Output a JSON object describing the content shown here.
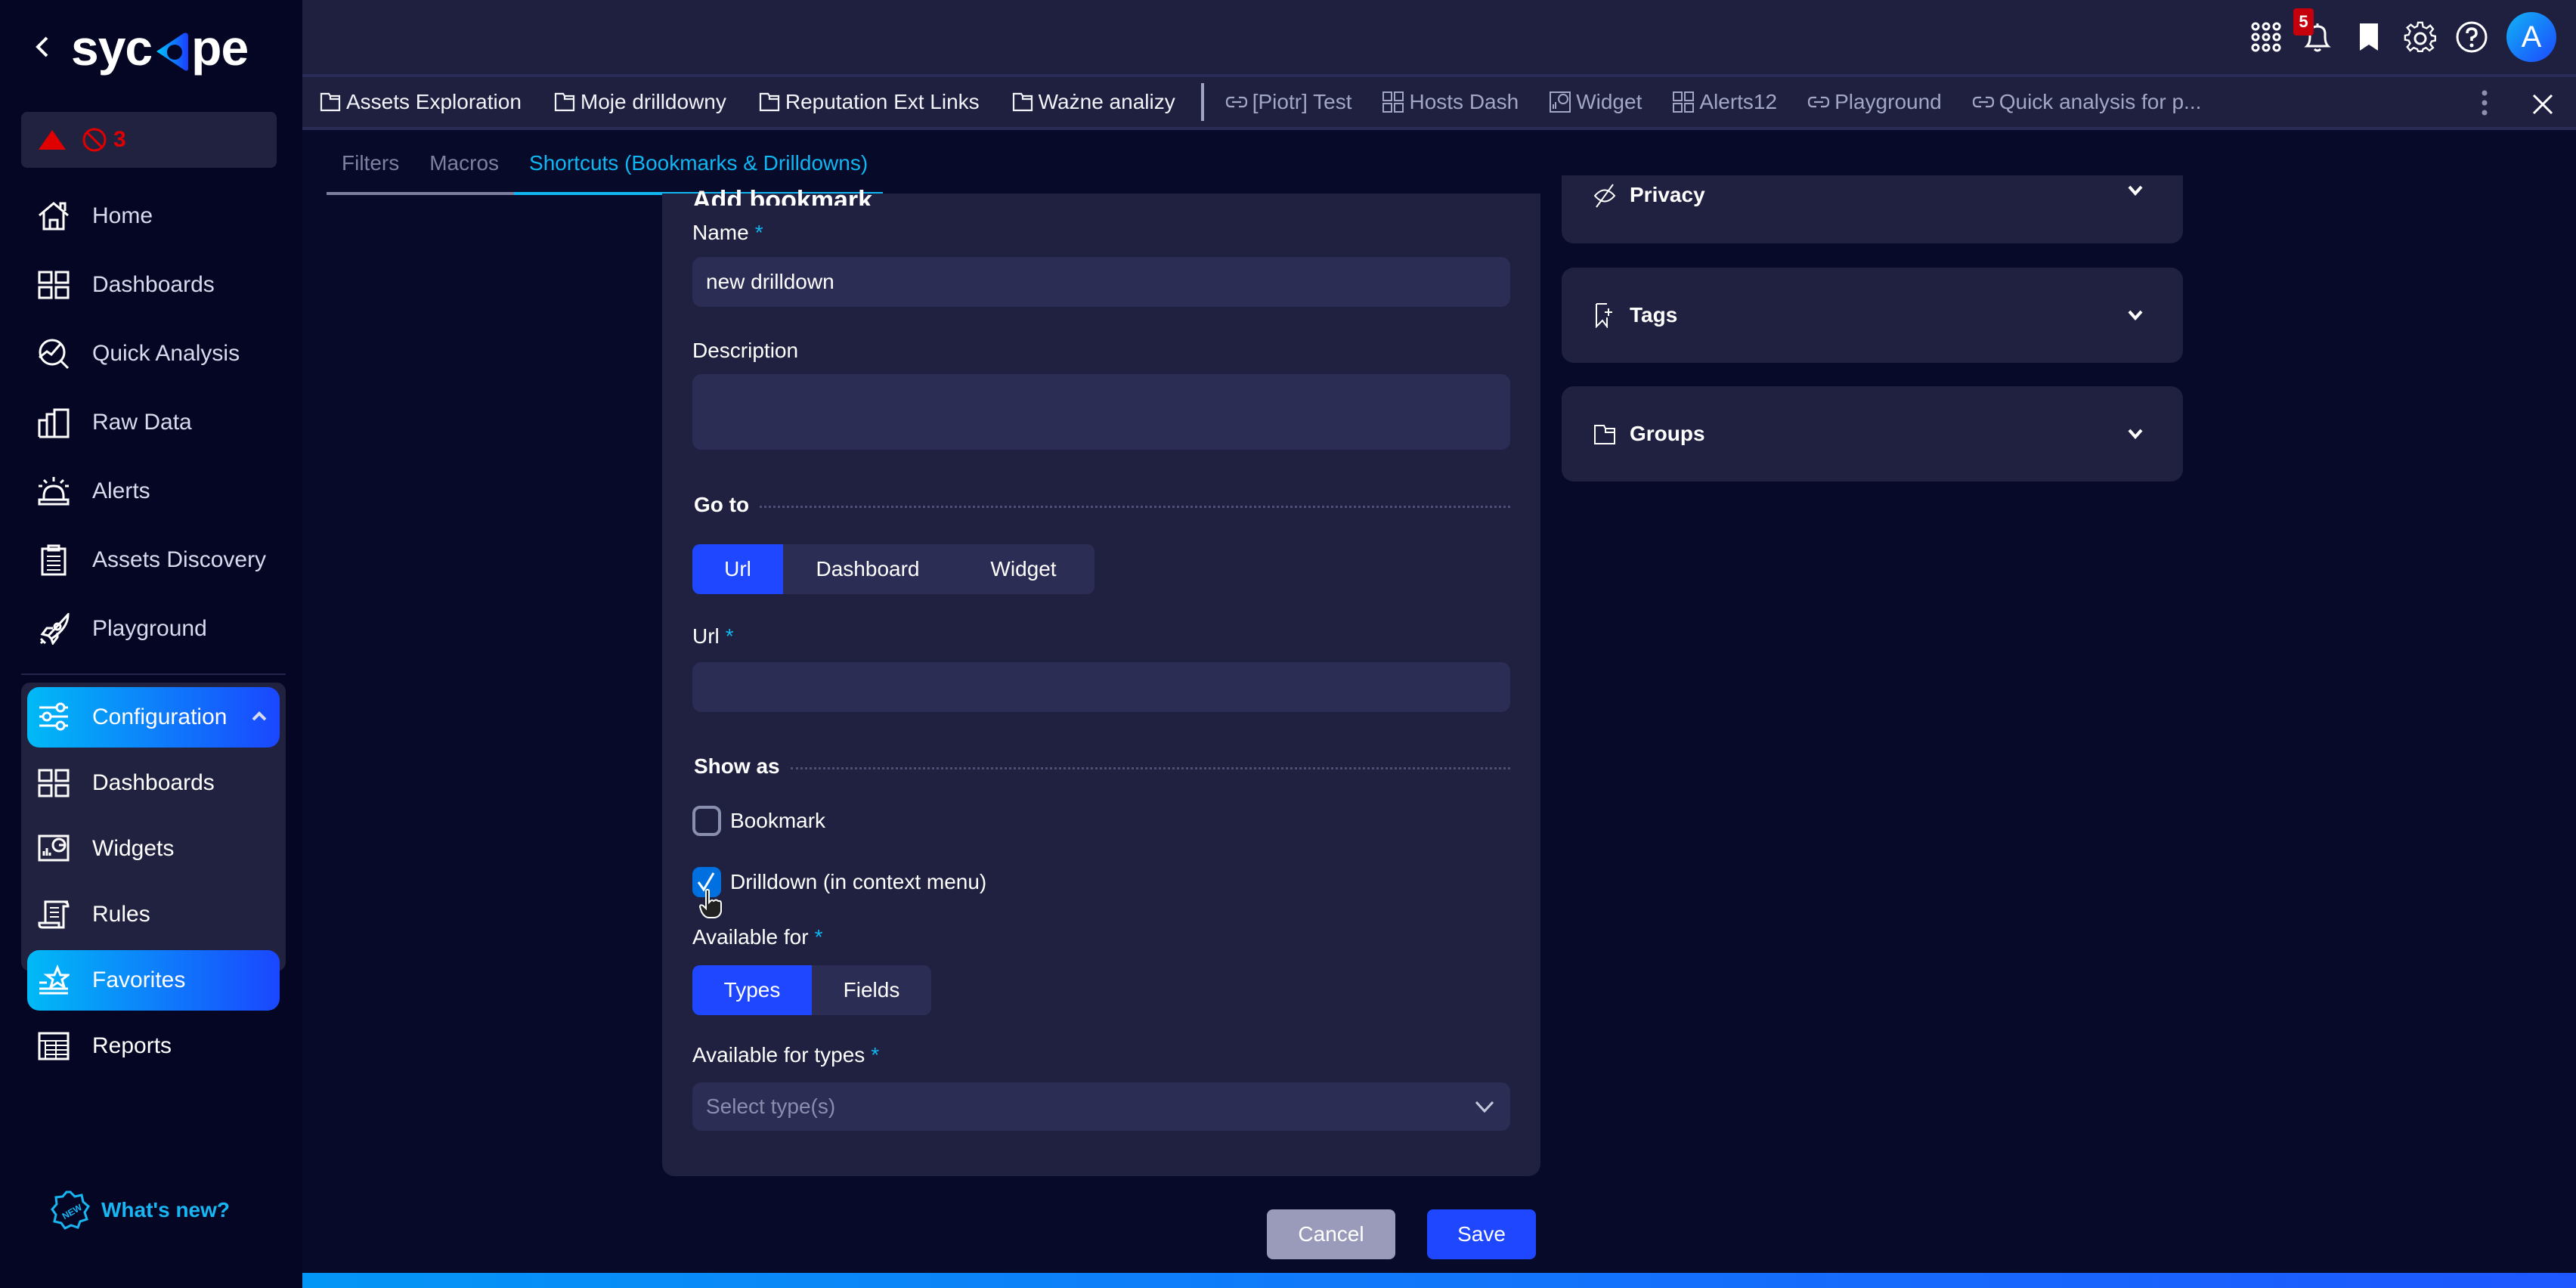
{
  "app": {
    "logo_text": "sycope"
  },
  "alerts": {
    "count": "3"
  },
  "sidebar": {
    "items": [
      {
        "label": "Home",
        "icon": "home-icon"
      },
      {
        "label": "Dashboards",
        "icon": "dashboards-icon"
      },
      {
        "label": "Quick Analysis",
        "icon": "quick-analysis-icon"
      },
      {
        "label": "Raw Data",
        "icon": "bar-chart-icon"
      },
      {
        "label": "Alerts",
        "icon": "siren-icon"
      },
      {
        "label": "Assets Discovery",
        "icon": "clipboard-icon"
      },
      {
        "label": "Playground",
        "icon": "rocket-icon"
      }
    ],
    "configuration": {
      "label": "Configuration",
      "expanded": true,
      "items": [
        {
          "label": "Dashboards",
          "icon": "dashboards-icon",
          "active": false
        },
        {
          "label": "Widgets",
          "icon": "widget-icon",
          "active": false
        },
        {
          "label": "Rules",
          "icon": "scroll-icon",
          "active": false
        },
        {
          "label": "Favorites",
          "icon": "star-list-icon",
          "active": true
        },
        {
          "label": "Reports",
          "icon": "table-icon",
          "active": false
        }
      ]
    },
    "whats_new": "What's new?"
  },
  "topbar": {
    "notification_count": "5",
    "avatar_initial": "A"
  },
  "shortcuts": {
    "folders": [
      "Assets Exploration",
      "Moje drilldowny",
      "Reputation Ext Links",
      "Ważne analizy"
    ],
    "links": [
      {
        "label": "[Piotr] Test",
        "icon": "link-icon"
      },
      {
        "label": "Hosts Dash",
        "icon": "dashboards-icon"
      },
      {
        "label": "Widget",
        "icon": "widget-icon"
      },
      {
        "label": "Alerts12",
        "icon": "dashboards-icon"
      },
      {
        "label": "Playground",
        "icon": "link-icon"
      },
      {
        "label": "Quick analysis for p...",
        "icon": "link-icon"
      }
    ]
  },
  "tabs": [
    {
      "label": "Filters",
      "active": false
    },
    {
      "label": "Macros",
      "active": false
    },
    {
      "label": "Shortcuts (Bookmarks & Drilldowns)",
      "active": true
    }
  ],
  "form": {
    "title": "Add bookmark",
    "name_label": "Name",
    "name_value": "new drilldown",
    "description_label": "Description",
    "description_value": "",
    "goto_section": "Go to",
    "goto_options": [
      {
        "label": "Url",
        "active": true
      },
      {
        "label": "Dashboard",
        "active": false
      },
      {
        "label": "Widget",
        "active": false
      }
    ],
    "url_label": "Url",
    "url_value": "",
    "show_as_section": "Show as",
    "bookmark_label": "Bookmark",
    "bookmark_checked": false,
    "drilldown_label": "Drilldown (in context menu)",
    "drilldown_checked": true,
    "available_for_label": "Available for",
    "available_for_options": [
      {
        "label": "Types",
        "active": true
      },
      {
        "label": "Fields",
        "active": false
      }
    ],
    "available_types_label": "Available for types",
    "available_types_placeholder": "Select type(s)",
    "required_marker": "*"
  },
  "panels": [
    {
      "label": "Privacy",
      "icon": "privacy-icon"
    },
    {
      "label": "Tags",
      "icon": "tag-bookmark-icon"
    },
    {
      "label": "Groups",
      "icon": "folder-icon"
    }
  ],
  "footer": {
    "cancel_label": "Cancel",
    "save_label": "Save"
  },
  "colors": {
    "accent": "#1e47ff",
    "accent_cyan": "#10b6f1",
    "alert_red": "#e00000",
    "checkbox_blue": "#0070e0"
  }
}
